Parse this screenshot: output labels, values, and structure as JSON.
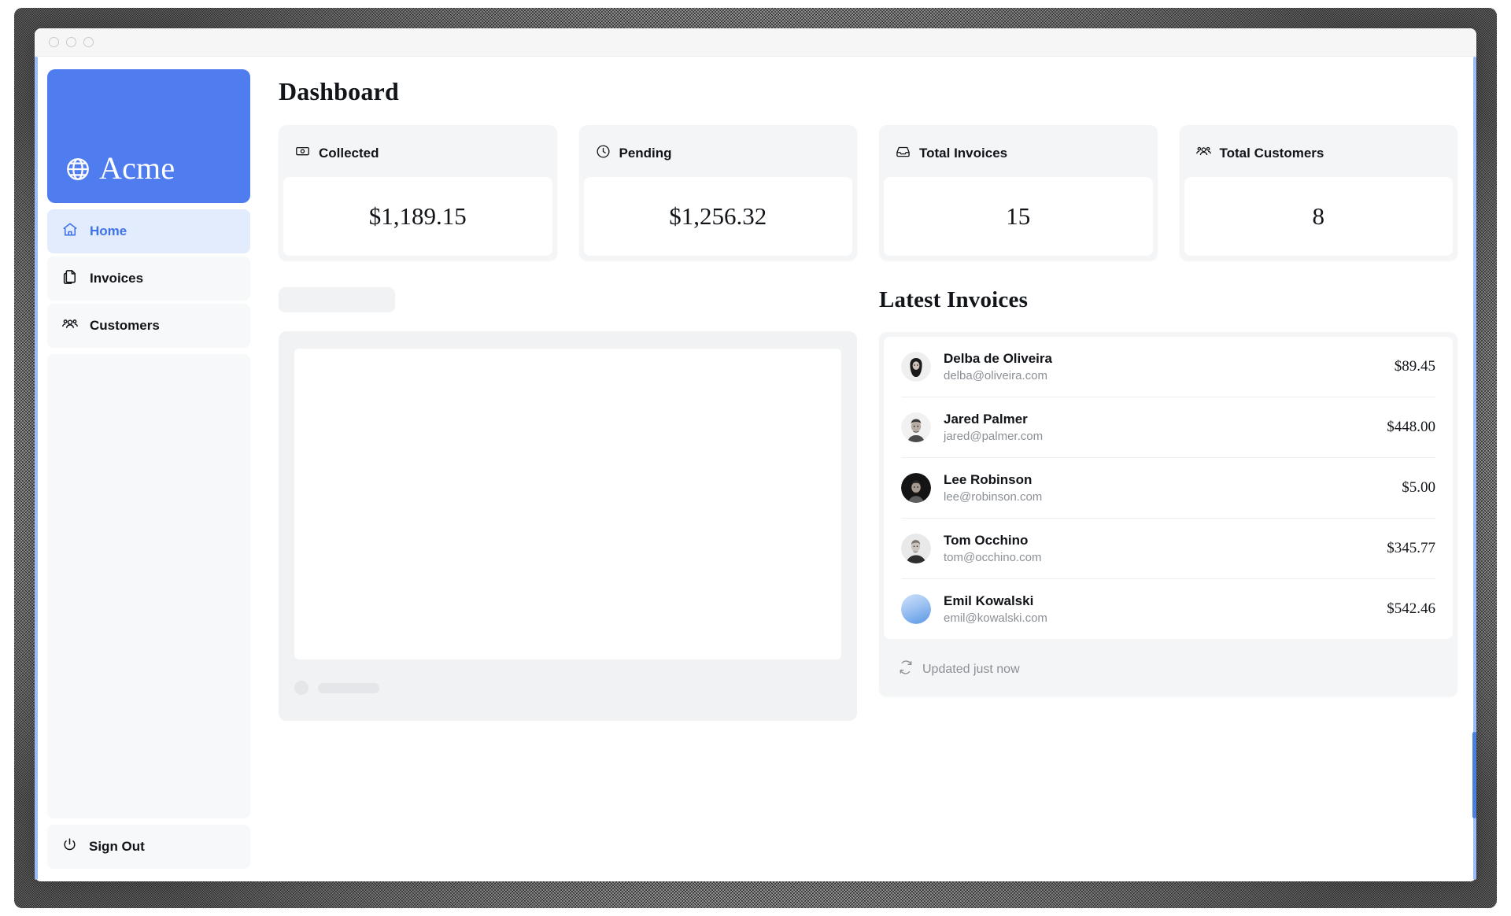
{
  "window": {
    "traffic_lights": [
      "window-dot-1",
      "window-dot-2",
      "window-dot-3"
    ]
  },
  "sidebar": {
    "logo": {
      "text": "Acme",
      "icon": "globe-icon",
      "background": "#4f7df0"
    },
    "items": [
      {
        "label": "Home",
        "icon": "home-icon",
        "active": true
      },
      {
        "label": "Invoices",
        "icon": "documents-icon",
        "active": false
      },
      {
        "label": "Customers",
        "icon": "users-group-icon",
        "active": false
      }
    ],
    "sign_out": {
      "label": "Sign Out",
      "icon": "power-icon"
    }
  },
  "main": {
    "page_title": "Dashboard",
    "stats": [
      {
        "label": "Collected",
        "value": "$1,189.15",
        "icon": "banknote-icon"
      },
      {
        "label": "Pending",
        "value": "$1,256.32",
        "icon": "clock-icon"
      },
      {
        "label": "Total Invoices",
        "value": "15",
        "icon": "inbox-icon"
      },
      {
        "label": "Total Customers",
        "value": "8",
        "icon": "users-group-icon"
      }
    ],
    "revenue_chart": {
      "state": "loading",
      "title_placeholder": "",
      "footer_placeholder": ""
    },
    "latest_invoices": {
      "title": "Latest Invoices",
      "rows": [
        {
          "name": "Delba de Oliveira",
          "email": "delba@oliveira.com",
          "amount": "$89.45",
          "avatar": "avatar-delba"
        },
        {
          "name": "Jared Palmer",
          "email": "jared@palmer.com",
          "amount": "$448.00",
          "avatar": "avatar-jared"
        },
        {
          "name": "Lee Robinson",
          "email": "lee@robinson.com",
          "amount": "$5.00",
          "avatar": "avatar-lee"
        },
        {
          "name": "Tom Occhino",
          "email": "tom@occhino.com",
          "amount": "$345.77",
          "avatar": "avatar-tom"
        },
        {
          "name": "Emil Kowalski",
          "email": "emil@kowalski.com",
          "amount": "$542.46",
          "avatar": "avatar-emil"
        }
      ],
      "updated_label": "Updated just now",
      "updated_icon": "refresh-icon"
    }
  },
  "colors": {
    "brand_blue": "#4f7df0",
    "active_nav_bg": "#e2ecfd",
    "active_nav_text": "#3f72e8",
    "panel_gray": "#f4f5f6",
    "muted_text": "#8b9096"
  }
}
